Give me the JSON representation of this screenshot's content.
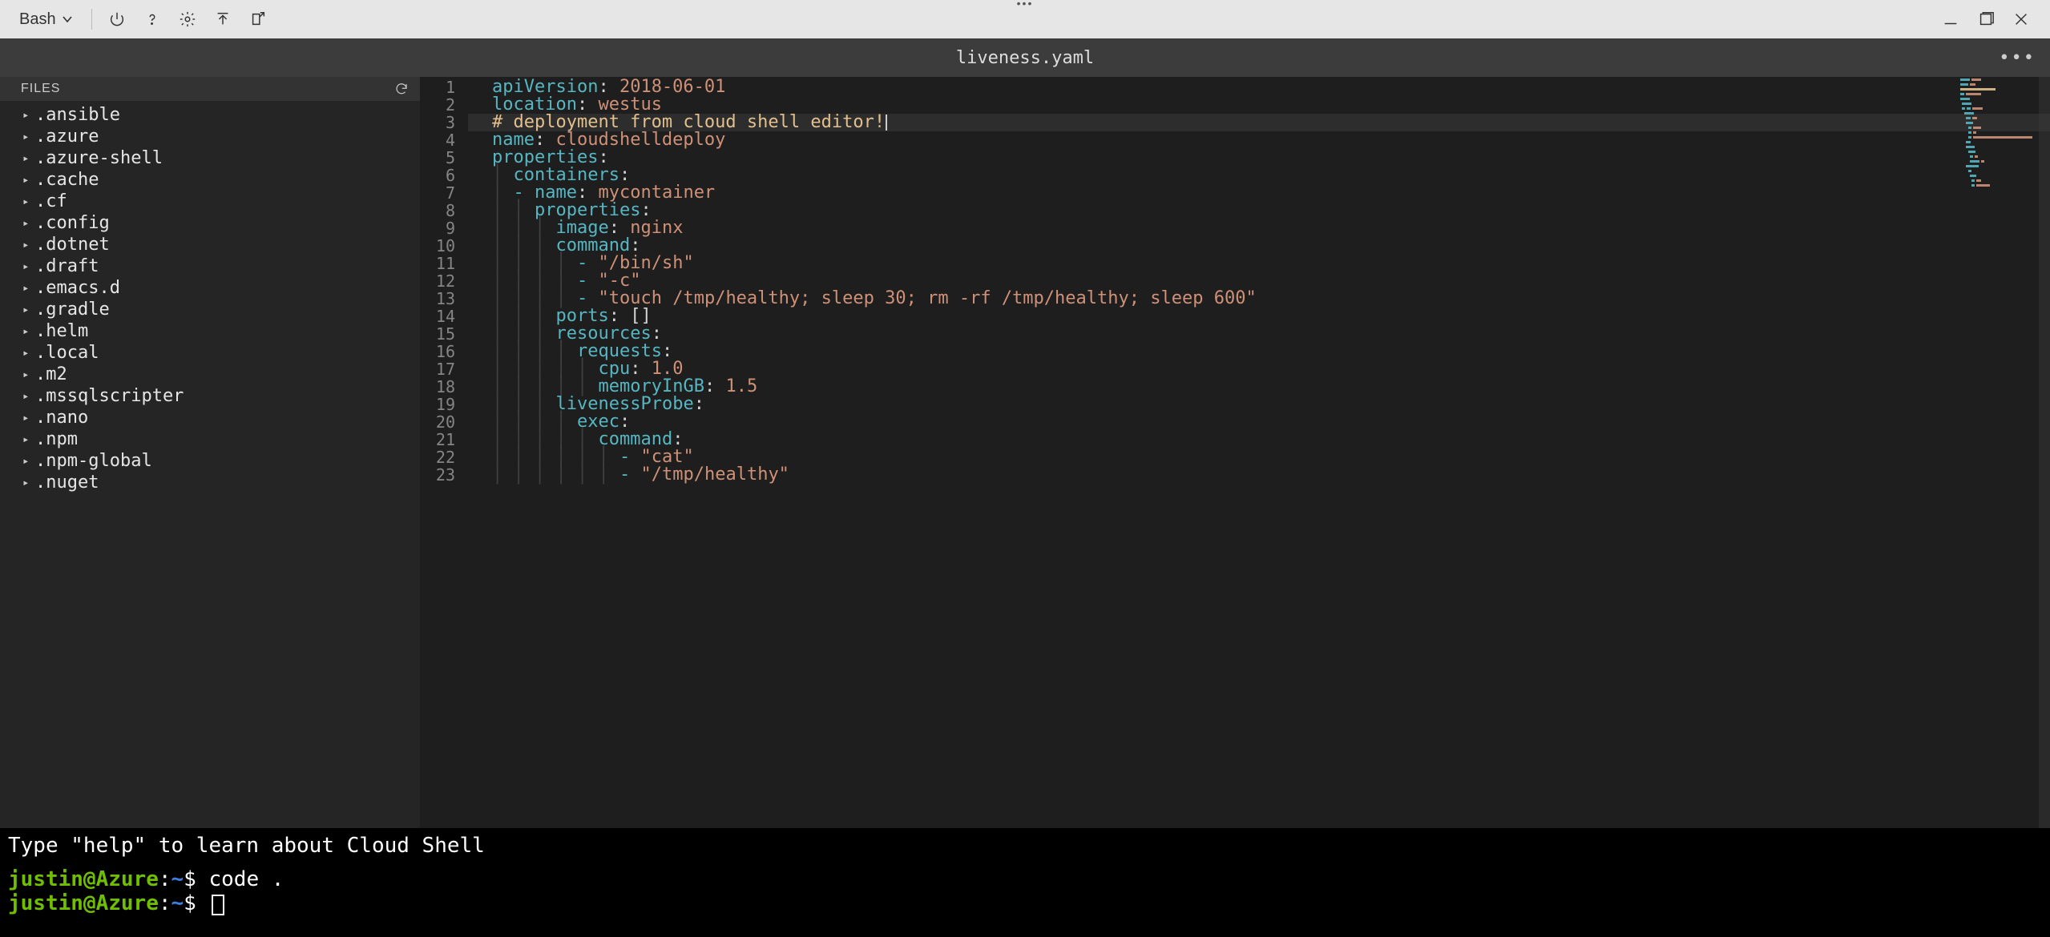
{
  "toolbar": {
    "shell_label": "Bash"
  },
  "tab": {
    "filename": "liveness.yaml"
  },
  "sidebar": {
    "header": "FILES",
    "items": [
      ".ansible",
      ".azure",
      ".azure-shell",
      ".cache",
      ".cf",
      ".config",
      ".dotnet",
      ".draft",
      ".emacs.d",
      ".gradle",
      ".helm",
      ".local",
      ".m2",
      ".mssqlscripter",
      ".nano",
      ".npm",
      ".npm-global",
      ".nuget"
    ]
  },
  "code": {
    "lines": [
      {
        "n": 1,
        "t": [
          [
            "k",
            "apiVersion"
          ],
          [
            "p",
            ": "
          ],
          [
            "v",
            "2018-06-01"
          ]
        ]
      },
      {
        "n": 2,
        "t": [
          [
            "k",
            "location"
          ],
          [
            "p",
            ": "
          ],
          [
            "v",
            "westus"
          ]
        ]
      },
      {
        "n": 3,
        "t": [
          [
            "c",
            "# deployment from cloud shell editor!"
          ]
        ],
        "sel": true,
        "cursor": true
      },
      {
        "n": 4,
        "t": [
          [
            "k",
            "name"
          ],
          [
            "p",
            ": "
          ],
          [
            "v",
            "cloudshelldeploy"
          ]
        ]
      },
      {
        "n": 5,
        "t": [
          [
            "k",
            "properties"
          ],
          [
            "p",
            ":"
          ]
        ]
      },
      {
        "n": 6,
        "t": [
          [
            "p",
            "  "
          ],
          [
            "k",
            "containers"
          ],
          [
            "p",
            ":"
          ]
        ]
      },
      {
        "n": 7,
        "t": [
          [
            "p",
            "  "
          ],
          [
            "dash",
            "- "
          ],
          [
            "k",
            "name"
          ],
          [
            "p",
            ": "
          ],
          [
            "v",
            "mycontainer"
          ]
        ]
      },
      {
        "n": 8,
        "t": [
          [
            "p",
            "    "
          ],
          [
            "k",
            "properties"
          ],
          [
            "p",
            ":"
          ]
        ]
      },
      {
        "n": 9,
        "t": [
          [
            "p",
            "      "
          ],
          [
            "k",
            "image"
          ],
          [
            "p",
            ": "
          ],
          [
            "v",
            "nginx"
          ]
        ]
      },
      {
        "n": 10,
        "t": [
          [
            "p",
            "      "
          ],
          [
            "k",
            "command"
          ],
          [
            "p",
            ":"
          ]
        ]
      },
      {
        "n": 11,
        "t": [
          [
            "p",
            "        "
          ],
          [
            "dash",
            "- "
          ],
          [
            "v",
            "\"/bin/sh\""
          ]
        ]
      },
      {
        "n": 12,
        "t": [
          [
            "p",
            "        "
          ],
          [
            "dash",
            "- "
          ],
          [
            "v",
            "\"-c\""
          ]
        ]
      },
      {
        "n": 13,
        "t": [
          [
            "p",
            "        "
          ],
          [
            "dash",
            "- "
          ],
          [
            "v",
            "\"touch /tmp/healthy; sleep 30; rm -rf /tmp/healthy; sleep 600\""
          ]
        ]
      },
      {
        "n": 14,
        "t": [
          [
            "p",
            "      "
          ],
          [
            "k",
            "ports"
          ],
          [
            "p",
            ": []"
          ]
        ]
      },
      {
        "n": 15,
        "t": [
          [
            "p",
            "      "
          ],
          [
            "k",
            "resources"
          ],
          [
            "p",
            ":"
          ]
        ]
      },
      {
        "n": 16,
        "t": [
          [
            "p",
            "        "
          ],
          [
            "k",
            "requests"
          ],
          [
            "p",
            ":"
          ]
        ]
      },
      {
        "n": 17,
        "t": [
          [
            "p",
            "          "
          ],
          [
            "k",
            "cpu"
          ],
          [
            "p",
            ": "
          ],
          [
            "n",
            "1.0"
          ]
        ]
      },
      {
        "n": 18,
        "t": [
          [
            "p",
            "          "
          ],
          [
            "k",
            "memoryInGB"
          ],
          [
            "p",
            ": "
          ],
          [
            "n",
            "1.5"
          ]
        ]
      },
      {
        "n": 19,
        "t": [
          [
            "p",
            "      "
          ],
          [
            "k",
            "livenessProbe"
          ],
          [
            "p",
            ":"
          ]
        ]
      },
      {
        "n": 20,
        "t": [
          [
            "p",
            "        "
          ],
          [
            "k",
            "exec"
          ],
          [
            "p",
            ":"
          ]
        ]
      },
      {
        "n": 21,
        "t": [
          [
            "p",
            "          "
          ],
          [
            "k",
            "command"
          ],
          [
            "p",
            ":"
          ]
        ]
      },
      {
        "n": 22,
        "t": [
          [
            "p",
            "            "
          ],
          [
            "dash",
            "- "
          ],
          [
            "v",
            "\"cat\""
          ]
        ]
      },
      {
        "n": 23,
        "t": [
          [
            "p",
            "            "
          ],
          [
            "dash",
            "- "
          ],
          [
            "v",
            "\"/tmp/healthy\""
          ]
        ]
      }
    ]
  },
  "terminal": {
    "intro": "Type \"help\" to learn about Cloud Shell",
    "user": "justin",
    "host": "Azure",
    "path": "~",
    "history": [
      {
        "cmd": "code ."
      },
      {
        "cmd": "",
        "cursor": true
      }
    ]
  }
}
